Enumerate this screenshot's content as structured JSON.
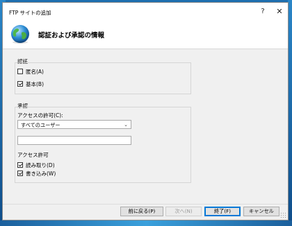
{
  "window": {
    "title": "FTP サイトの追加",
    "help_glyph": "?",
    "close_glyph": "✕"
  },
  "header": {
    "title": "認証および承認の情報",
    "icon": "globe-icon"
  },
  "auth": {
    "label": "認証",
    "anonymous": {
      "label": "匿名(A)",
      "checked": false
    },
    "basic": {
      "label": "基本(B)",
      "checked": true
    }
  },
  "authz": {
    "label": "承認",
    "access_label": "アクセスの許可(C):",
    "access_value": "すべてのユーザー",
    "text_value": "",
    "perms_label": "アクセス許可",
    "read": {
      "label": "読み取り(D)",
      "checked": true
    },
    "write": {
      "label": "書き込み(W)",
      "checked": true
    }
  },
  "buttons": {
    "back": "前に戻る(P)",
    "next": "次へ(N)",
    "finish": "終了(F)",
    "cancel": "キャンセル"
  }
}
